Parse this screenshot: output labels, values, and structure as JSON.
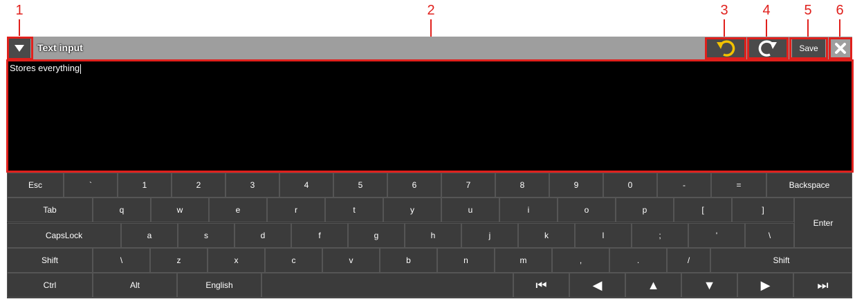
{
  "callouts": [
    "1",
    "2",
    "3",
    "4",
    "5",
    "6"
  ],
  "titlebar": {
    "title": "Text input",
    "menu_icon": "triangle-down-icon",
    "undo_icon": "undo-icon",
    "redo_icon": "redo-icon",
    "save_label": "Save",
    "close_icon": "close-icon",
    "accent": "#f2c200",
    "callout_color": "#e0201c"
  },
  "editor": {
    "text": "Stores everything"
  },
  "keyboard": {
    "rows": [
      [
        "Esc",
        "`",
        "1",
        "2",
        "3",
        "4",
        "5",
        "6",
        "7",
        "8",
        "9",
        "0",
        "-",
        "=",
        "Backspace"
      ],
      [
        "Tab",
        "q",
        "w",
        "e",
        "r",
        "t",
        "y",
        "u",
        "i",
        "o",
        "p",
        "[",
        "]",
        "Enter"
      ],
      [
        "CapsLock",
        "a",
        "s",
        "d",
        "f",
        "g",
        "h",
        "j",
        "k",
        "l",
        ";",
        "'",
        "\\"
      ],
      [
        "Shift",
        "\\",
        "z",
        "x",
        "c",
        "v",
        "b",
        "n",
        "m",
        ",",
        ".",
        "/",
        "Shift"
      ],
      [
        "Ctrl",
        "Alt",
        "English",
        "",
        "⏮",
        "◀",
        "▲",
        "▼",
        "▶",
        "⏭"
      ]
    ],
    "nav_icons": [
      "jump-start-icon",
      "arrow-left-icon",
      "arrow-up-icon",
      "arrow-down-icon",
      "arrow-right-icon",
      "jump-end-icon"
    ]
  }
}
